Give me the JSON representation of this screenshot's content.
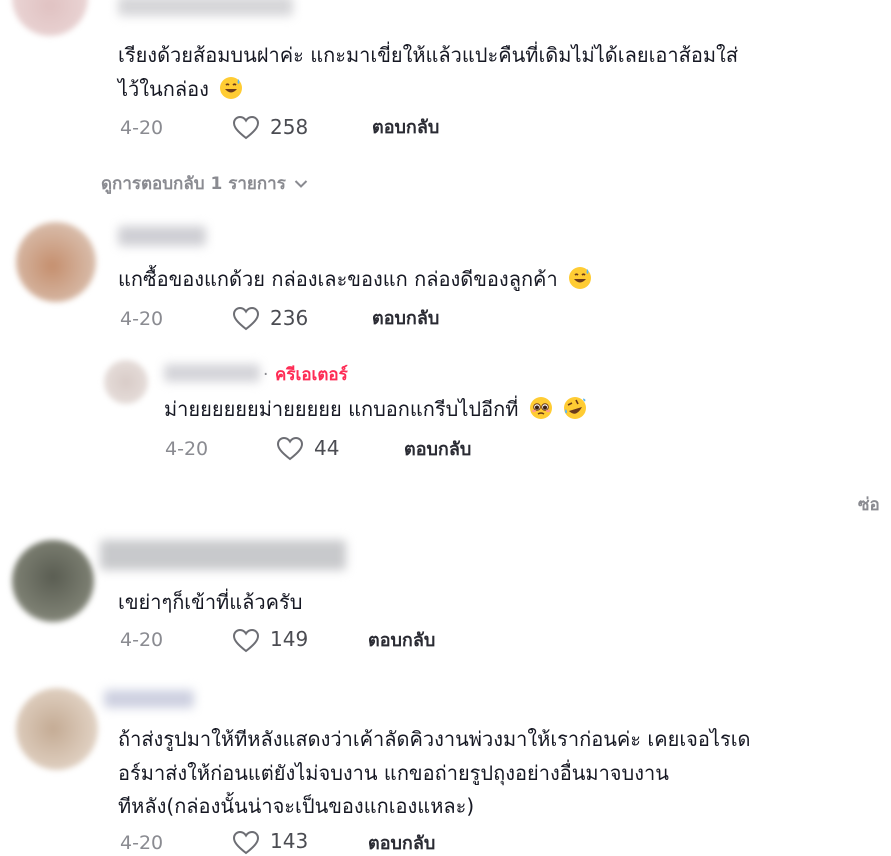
{
  "comments": [
    {
      "text_lines": [
        "เรียงด้วยส้อมบนฝาค่ะ แกะมาเขี่ยให้แล้วแปะคืนที่เดิมไม่ได้เลยเอาส้อมใส่",
        "ไว้ในกล่อง"
      ],
      "emoji": "grinning-sweat-emoji",
      "date": "4-20",
      "likes": "258",
      "reply_label": "ตอบกลับ",
      "view_replies": "ดูการตอบกลับ 1 รายการ"
    },
    {
      "text_lines": [
        "แกซื้อของแกด้วย กล่องเละของแก กล่องดีของลูกค้า"
      ],
      "emoji": "grinning-sweat-emoji",
      "date": "4-20",
      "likes": "236",
      "reply_label": "ตอบกลับ",
      "reply": {
        "creator_label": "ครีเอเตอร์",
        "separator": "·",
        "text": "ม่ายยยยยยม่ายยยยย แกบอกแกรีบไปอีกที่",
        "emojis": [
          "pleading-face-emoji",
          "rolling-laughing-emoji"
        ],
        "date": "4-20",
        "likes": "44",
        "reply_label": "ตอบกลับ"
      }
    },
    {
      "text_lines": [
        "เขย่าๆก็เข้าที่แล้วครับ"
      ],
      "date": "4-20",
      "likes": "149",
      "reply_label": "ตอบกลับ"
    },
    {
      "text_lines": [
        "ถ้าส่งรูปมาให้ทีหลังแสดงว่าเค้าลัดคิวงานพ่วงมาให้เราก่อนค่ะ เคยเจอไรเด",
        "อร์มาส่งให้ก่อนแต่ยังไม่จบงาน แกขอถ่ายรูปถุงอย่างอื่นมาจบงาน",
        "ทีหลัง(กล่องนั้นน่าจะเป็นของแกเองแหละ)"
      ],
      "date": "4-20",
      "likes": "143",
      "reply_label": "ตอบกลับ"
    }
  ],
  "side_more_label": "ซ่อ",
  "colors": {
    "text": "#161823",
    "muted": "#8a8b91",
    "creator": "#fe2c55"
  }
}
